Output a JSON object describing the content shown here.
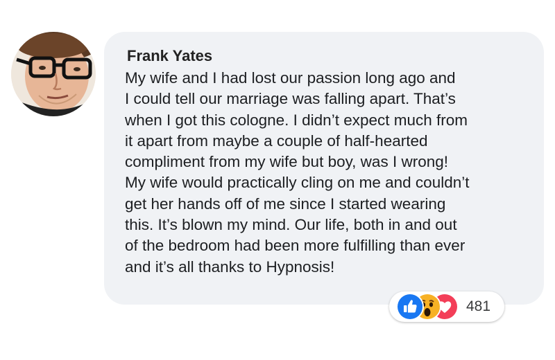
{
  "comment": {
    "author": "Frank Yates",
    "lines": [
      "My wife and I had lost our passion long ago and",
      "I could tell our marriage was falling apart. That’s",
      "when I got this cologne. I didn’t expect much from",
      "it apart from maybe a couple of half-hearted",
      "compliment from my wife but boy, was I wrong!",
      "My wife would practically cling on me and couldn’t",
      "get her hands off of me since I started wearing",
      "this. It’s blown my mind. Our life, both in and out",
      "of the bedroom had been more fulfilling than ever",
      "and it’s all thanks to Hypnosis!"
    ]
  },
  "reactions": {
    "icons": [
      "like-icon",
      "wow-icon",
      "love-icon"
    ],
    "count": "481"
  },
  "colors": {
    "bubble": "#f0f2f5",
    "like": "#1877f2",
    "wow": "#f7b125",
    "love": "#f33e58"
  }
}
